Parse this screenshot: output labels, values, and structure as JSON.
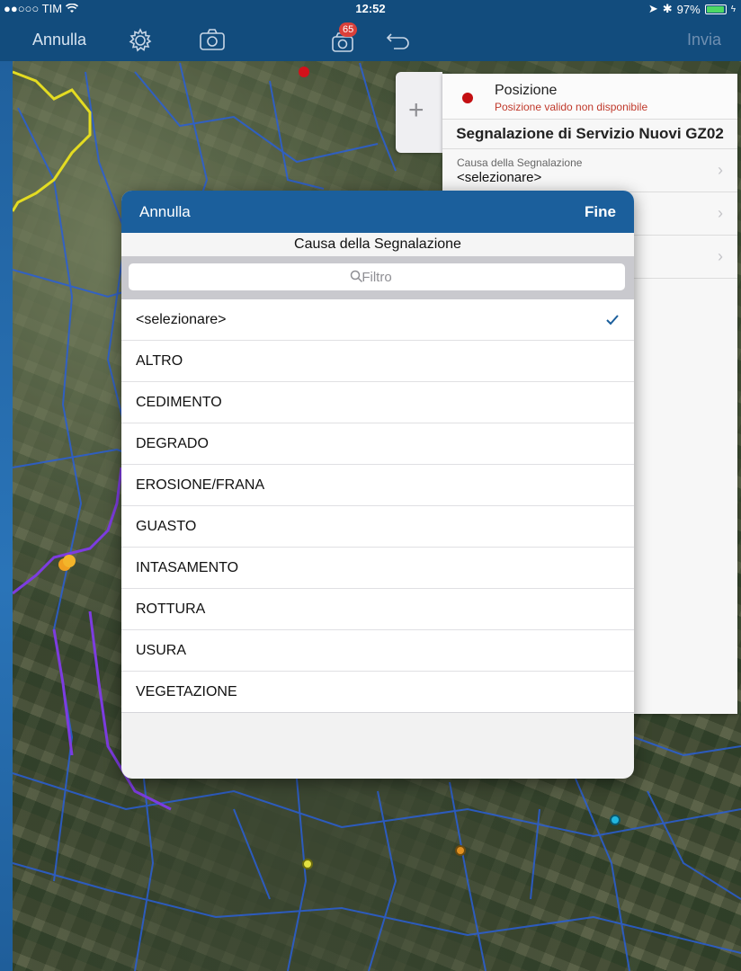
{
  "status_bar": {
    "carrier": "●●○○○ TIM",
    "time": "12:52",
    "battery": "97%",
    "battery_level": 0.97
  },
  "toolbar": {
    "cancel_label": "Annulla",
    "send_label": "Invia",
    "badge_count": "65",
    "icons": [
      "gear-icon",
      "camera-icon",
      "photo-stack-icon",
      "undo-icon"
    ]
  },
  "form": {
    "position_title": "Posizione",
    "position_subtitle": "Posizione valido non disponibile",
    "title": "Segnalazione di Servizio Nuovi GZ02",
    "fields": [
      {
        "label": "Causa della Segnalazione",
        "value": "<selezionare>"
      }
    ]
  },
  "picker": {
    "cancel_label": "Annulla",
    "done_label": "Fine",
    "title": "Causa della Segnalazione",
    "search_placeholder": "Filtro",
    "selected_index": 0,
    "options": [
      "<selezionare>",
      "ALTRO",
      "CEDIMENTO",
      "DEGRADO",
      "EROSIONE/FRANA",
      "GUASTO",
      "INTASAMENTO",
      "ROTTURA",
      "USURA",
      "VEGETAZIONE"
    ]
  },
  "colors": {
    "bar_blue": "#124c7d",
    "modal_nav_blue": "#1b5f9c",
    "check_blue": "#1b5f9c",
    "alert_red": "#c40f12"
  }
}
